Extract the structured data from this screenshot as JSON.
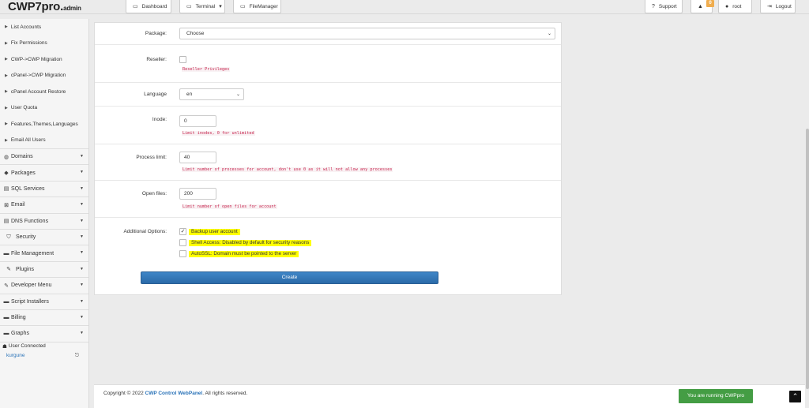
{
  "brand": {
    "name": "CWP7pro.",
    "suffix": "admin"
  },
  "topbar": {
    "dashboard": "Dashboard",
    "terminal": "Terminal",
    "filemanager": "FileManager",
    "support": "Support",
    "notifications_count": "0",
    "user": "root",
    "logout": "Logout"
  },
  "sidebar": {
    "sub_items": [
      "List Accounts",
      "Fix Permissions",
      "CWP->CWP Migration",
      "cPanel->CWP Migration",
      "cPanel Account Restore",
      "User Quota",
      "Features,Themes,Languages",
      "Email All Users"
    ],
    "menu": [
      "Domains",
      "Packages",
      "SQL Services",
      "Email",
      "DNS Functions",
      "Security",
      "File Management",
      "Plugins",
      "Developer Menu",
      "Script Installers",
      "Billing",
      "Graphs"
    ],
    "connected_label": "User Connected",
    "connected_user": "kurgune"
  },
  "form": {
    "package": {
      "label": "Package:",
      "value": "Choose"
    },
    "reseller": {
      "label": "Reseller:",
      "help": "Reseller Privileges"
    },
    "language": {
      "label": "Language",
      "value": "en"
    },
    "inode": {
      "label": "Inode:",
      "value": "0",
      "help": "Limit inodes, 0 for unlimited"
    },
    "process_limit": {
      "label": "Process limit:",
      "value": "40",
      "help": "Limit number of processes for account, don't use 0 as it will not allow any processes"
    },
    "open_files": {
      "label": "Open files:",
      "value": "200",
      "help": "Limit number of open files for account"
    },
    "additional": {
      "label": "Additional Options:",
      "backup": "Backup user account",
      "shell": "Shell Access: Disabled by default for security reasons",
      "autossl": "AutoSSL: Domain must be pointed to the server"
    },
    "create": "Create"
  },
  "footer": {
    "copyright": "Copyright © 2022",
    "brand_link": "CWP Control WebPanel",
    "rights": ". All rights reserved.",
    "running": "You are running CWPpro"
  }
}
